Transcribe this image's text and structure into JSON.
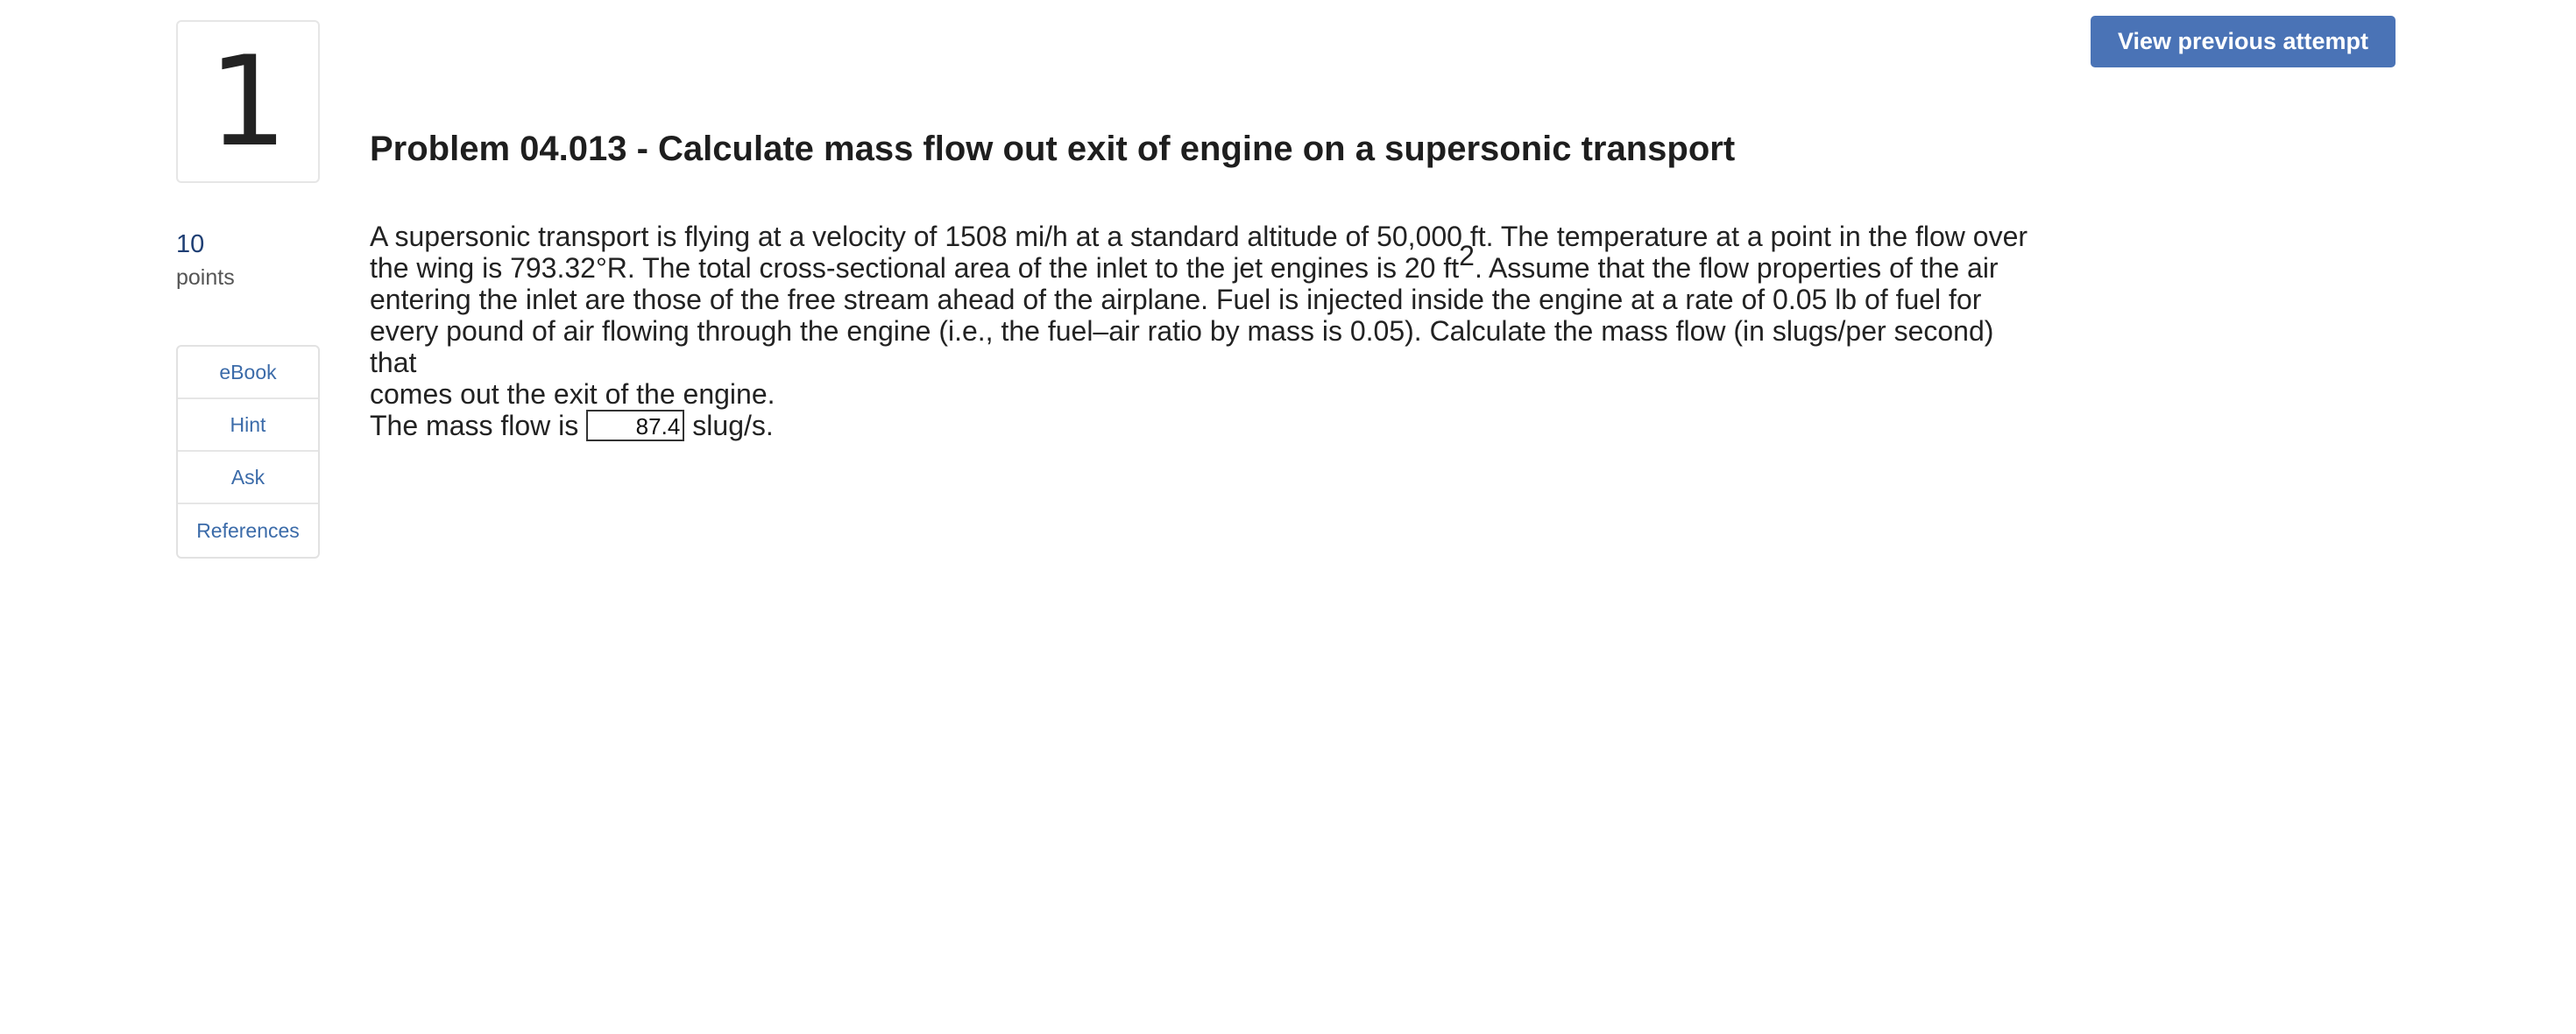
{
  "question": {
    "number": "1",
    "points_value": "10",
    "points_label": "points"
  },
  "tools": [
    {
      "label": "eBook"
    },
    {
      "label": "Hint"
    },
    {
      "label": "Ask"
    },
    {
      "label": "References"
    }
  ],
  "header": {
    "view_previous_label": "View previous attempt"
  },
  "problem": {
    "title": "Problem 04.013 - Calculate mass flow out exit of engine on a supersonic transport",
    "line1": "A supersonic transport is flying at a velocity of 1508 mi/h at a standard altitude of 50,000 ft. The temperature at a point in the flow over",
    "line2_pre": "the wing is 793.32°R. The total cross-sectional area of the inlet to the jet engines is 20 ft",
    "line2_sup": "2",
    "line2_post": ". Assume that the flow properties of the air",
    "line3": "entering the inlet are those of the free stream ahead of the airplane. Fuel is injected inside the engine at a rate of 0.05 lb of fuel for",
    "line4": "every pound of air flowing through the engine (i.e., the fuel–air ratio by mass is 0.05). Calculate the mass flow (in slugs/per second) that",
    "line5": "comes out the exit of the engine.",
    "answer_prefix": "The mass flow is",
    "answer_value": "87.4",
    "answer_unit": "slug/s."
  }
}
